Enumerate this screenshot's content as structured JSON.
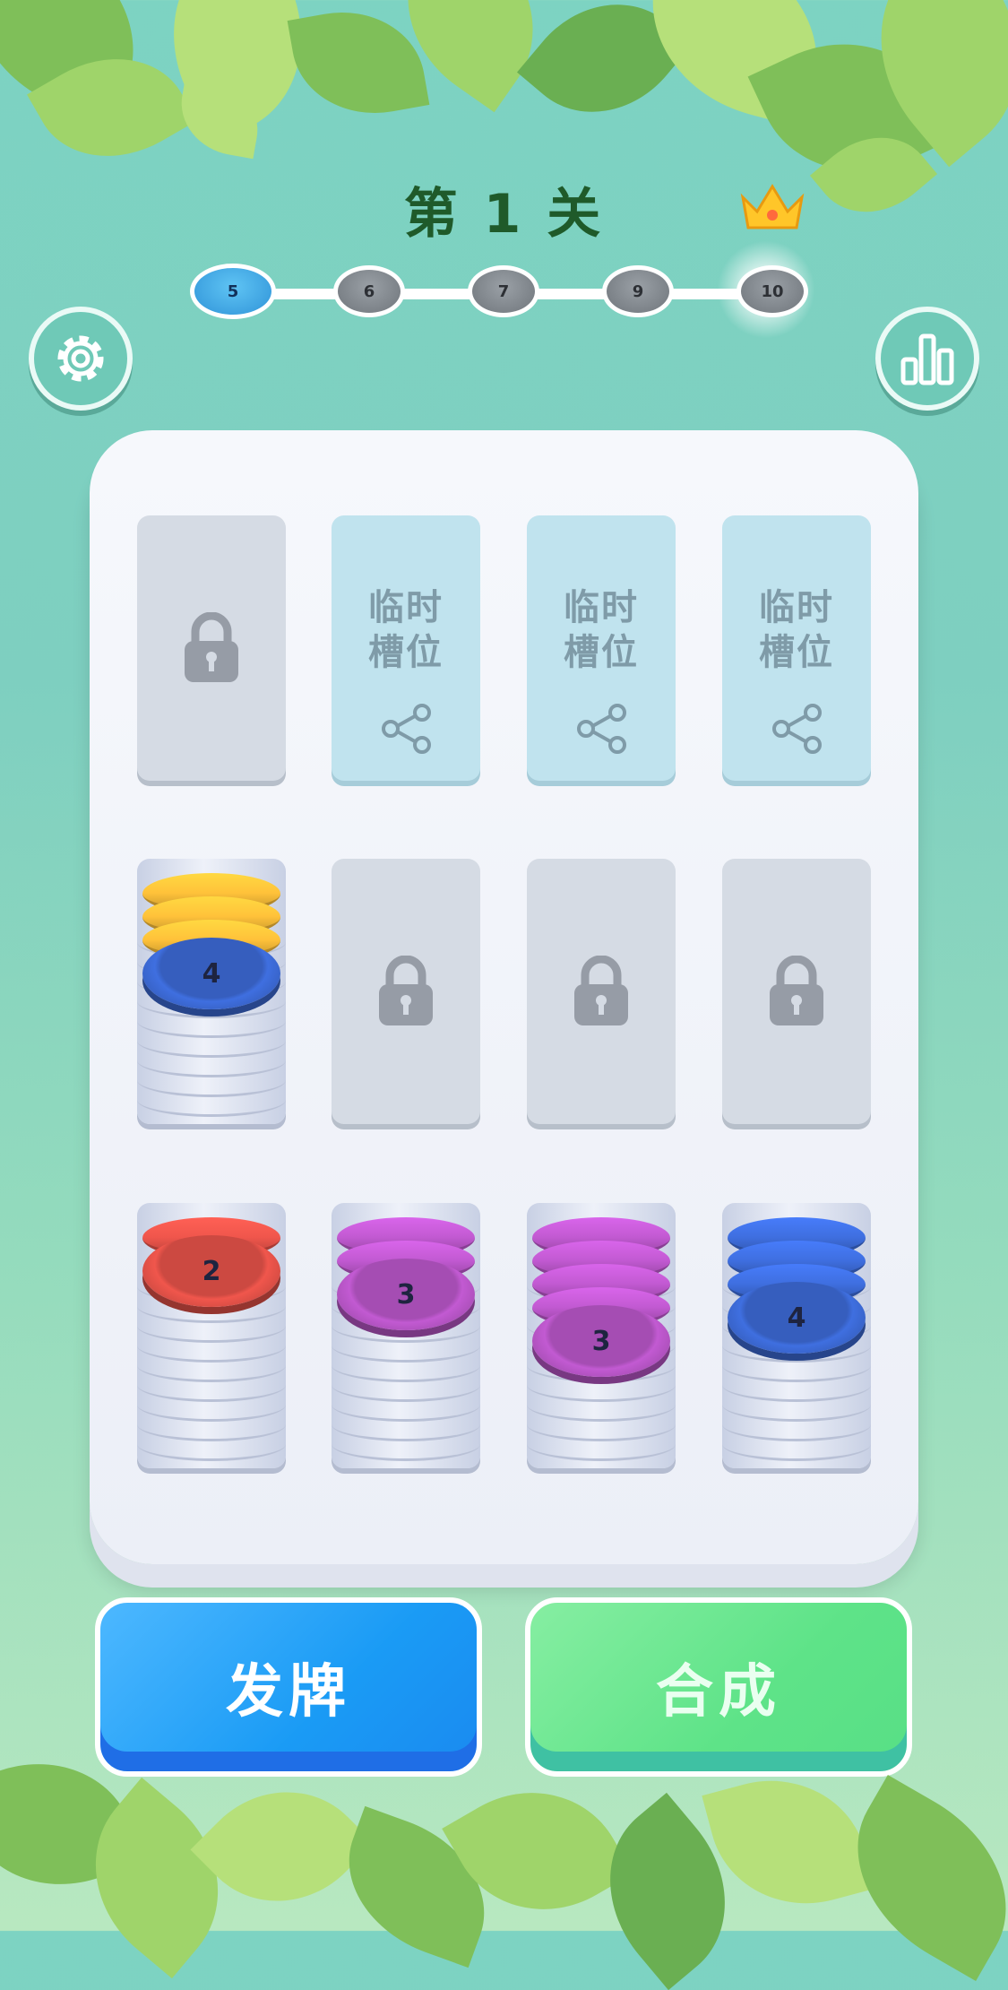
{
  "level_title": "第 1 关",
  "progress": {
    "nodes": [
      "5",
      "6",
      "7",
      "9",
      "10"
    ],
    "current_index": 0
  },
  "temp_slot": {
    "label_line1": "临时",
    "label_line2": "槽位"
  },
  "board": {
    "row1": [
      "locked",
      "temp",
      "temp",
      "temp"
    ],
    "row2": [
      {
        "type": "stack",
        "top_number": "4",
        "chips": [
          "blue",
          "yellow",
          "yellow",
          "yellow"
        ]
      },
      {
        "type": "locked"
      },
      {
        "type": "locked"
      },
      {
        "type": "locked"
      }
    ],
    "row3": [
      {
        "type": "stack",
        "top_number": "2",
        "chips": [
          "red",
          "red"
        ]
      },
      {
        "type": "stack",
        "top_number": "3",
        "chips": [
          "purple",
          "purple",
          "purple"
        ]
      },
      {
        "type": "stack",
        "top_number": "3",
        "chips": [
          "purple",
          "purple",
          "purple",
          "purple",
          "purple"
        ]
      },
      {
        "type": "stack",
        "top_number": "4",
        "chips": [
          "blue",
          "blue",
          "blue",
          "blue"
        ]
      }
    ]
  },
  "buttons": {
    "deal": "发牌",
    "merge": "合成"
  },
  "colors": {
    "blue": "#3f6fe0",
    "yellow": "#ffc23a",
    "red": "#f0564c",
    "purple": "#c25ad2"
  },
  "icons": {
    "settings": "gear-icon",
    "stats": "bar-chart-icon",
    "lock": "lock-icon",
    "share": "share-icon",
    "crown": "crown-icon"
  }
}
